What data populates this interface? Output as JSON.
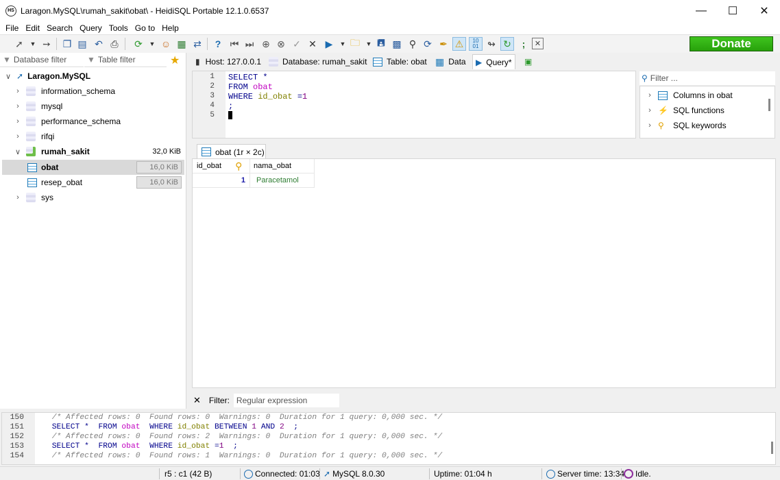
{
  "window": {
    "title": "Laragon.MySQL\\rumah_sakit\\obat\\ - HeidiSQL Portable 12.1.0.6537",
    "app_icon": "HS"
  },
  "menu": [
    "File",
    "Edit",
    "Search",
    "Query",
    "Tools",
    "Go to",
    "Help"
  ],
  "toolbar": {
    "donate_label": "Donate",
    "brand_color": "#2fb514"
  },
  "left": {
    "db_filter": "Database filter",
    "table_filter": "Table filter",
    "tree": {
      "root": "Laragon.MySQL",
      "dbs": [
        "information_schema",
        "mysql",
        "performance_schema",
        "rifqi"
      ],
      "open_db": {
        "name": "rumah_sakit",
        "size": "32,0 KiB"
      },
      "tables": [
        {
          "name": "obat",
          "size": "16,0 KiB"
        },
        {
          "name": "resep_obat",
          "size": "16,0 KiB"
        }
      ],
      "last_db": "sys"
    }
  },
  "tabs": [
    "Host: 127.0.0.1",
    "Database: rumah_sakit",
    "Table: obat",
    "Data",
    "Query*"
  ],
  "editor": {
    "line_numbers": [
      "1",
      "2",
      "3",
      "4",
      "5"
    ],
    "l1_kw": "SELECT",
    "l1_star": "*",
    "l2_kw": "FROM",
    "l2_tbl": "obat",
    "l3_kw": "WHERE",
    "l3_col": "id_obat",
    "l3_op": "=",
    "l3_num": "1",
    "l4": ";"
  },
  "helper": {
    "filter_placeholder": "Filter ...",
    "items": [
      "Columns in obat",
      "SQL functions",
      "SQL keywords"
    ]
  },
  "result": {
    "tab_label": "obat (1r × 2c)",
    "columns": [
      "id_obat",
      "nama_obat"
    ],
    "rows": [
      {
        "id_obat": "1",
        "nama_obat": "Paracetamol"
      }
    ]
  },
  "filter": {
    "label": "Filter:",
    "placeholder": "Regular expression"
  },
  "log": {
    "nums": [
      "150",
      "151",
      "152",
      "153",
      "154"
    ],
    "c150": "/* Affected rows: 0  Found rows: 0  Warnings: 0  Duration for 1 query: 0,000 sec. */",
    "c152": "/* Affected rows: 0  Found rows: 2  Warnings: 0  Duration for 1 query: 0,000 sec. */",
    "c154": "/* Affected rows: 0  Found rows: 1  Warnings: 0  Duration for 1 query: 0,000 sec. */",
    "q151": {
      "a": "SELECT *",
      "b": "FROM",
      "c": "obat",
      "d": "WHERE",
      "e": "id_obat",
      "f": "BETWEEN",
      "g": "1",
      "h": "AND",
      "i": "2",
      "j": ";"
    },
    "q153": {
      "a": "SELECT *",
      "b": "FROM",
      "c": "obat",
      "d": "WHERE",
      "e": "id_obat",
      "f": "=",
      "g": "1",
      "j": ";"
    }
  },
  "status": {
    "cursor": "r5 : c1 (42 B)",
    "connected": "Connected: 01:03",
    "server": "MySQL 8.0.30",
    "uptime": "Uptime: 01:04 h",
    "server_time": "Server time: 13:34",
    "state": "Idle."
  }
}
